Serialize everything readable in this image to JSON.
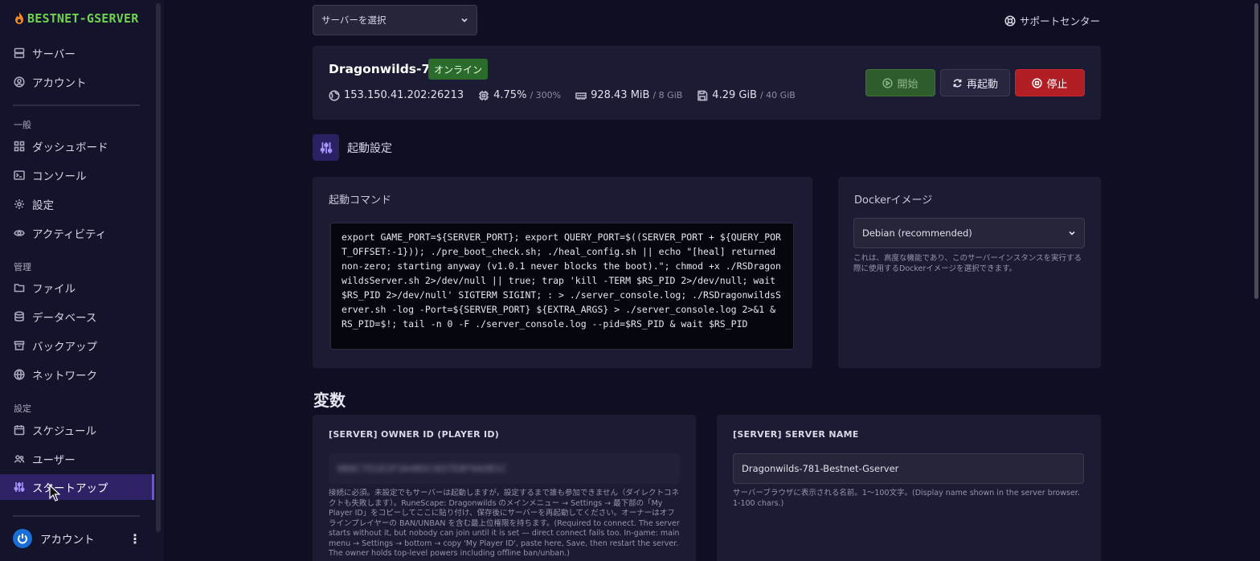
{
  "brand": {
    "name": "BESTNET-GSERVER"
  },
  "sidebar": {
    "top_items": [
      {
        "label": "サーバー",
        "icon": "server-icon"
      },
      {
        "label": "アカウント",
        "icon": "user-circle-icon"
      }
    ],
    "sections": [
      {
        "label": "一般"
      },
      {
        "label": "管理"
      },
      {
        "label": "設定"
      }
    ],
    "items": [
      {
        "label": "ダッシュボード",
        "icon": "grid-icon"
      },
      {
        "label": "コンソール",
        "icon": "terminal-icon"
      },
      {
        "label": "設定",
        "icon": "gear-icon"
      },
      {
        "label": "アクティビティ",
        "icon": "eye-icon"
      },
      {
        "label": "ファイル",
        "icon": "folder-icon"
      },
      {
        "label": "データベース",
        "icon": "database-icon"
      },
      {
        "label": "バックアップ",
        "icon": "archive-icon"
      },
      {
        "label": "ネットワーク",
        "icon": "network-icon"
      },
      {
        "label": "スケジュール",
        "icon": "calendar-icon"
      },
      {
        "label": "ユーザー",
        "icon": "users-icon"
      },
      {
        "label": "スタートアップ",
        "icon": "sliders-icon",
        "active": true
      }
    ],
    "footer": {
      "label": "アカウント",
      "icon": "power-icon"
    }
  },
  "header": {
    "server_select_placeholder": "サーバーを選択",
    "support_label": "サポートセンター"
  },
  "server": {
    "name": "Dragonwilds-781",
    "status": "オンライン",
    "address": "153.150.41.202:26213",
    "cpu": "4.75%",
    "cpu_limit": "/ 300%",
    "memory": "928.43 MiB",
    "memory_limit": "/ 8 GiB",
    "disk": "4.29 GiB",
    "disk_limit": "/ 40 GiB",
    "buttons": {
      "start": "開始",
      "restart": "再起動",
      "stop": "停止"
    }
  },
  "startup": {
    "section_title": "起動設定",
    "command_title": "起動コマンド",
    "command": "export GAME_PORT=${SERVER_PORT}; export QUERY_PORT=$((SERVER_PORT + ${QUERY_PORT_OFFSET:-1})); ./pre_boot_check.sh; ./heal_config.sh || echo \"[heal] returned non-zero; starting anyway (v1.0.1 never blocks the boot).\"; chmod +x ./RSDragonwildsServer.sh 2>/dev/null || true; trap 'kill -TERM $RS_PID 2>/dev/null; wait $RS_PID 2>/dev/null' SIGTERM SIGINT; : > ./server_console.log; ./RSDragonwildsServer.sh -log -Port=${SERVER_PORT} ${EXTRA_ARGS} > ./server_console.log 2>&1 & RS_PID=$!; tail -n 0 -F ./server_console.log --pid=$RS_PID & wait $RS_PID",
    "docker_title": "Dockerイメージ",
    "docker_value": "Debian (recommended)",
    "docker_help": "これは、高度な機能であり、このサーバーインスタンスを実行する際に使用するDockerイメージを選択できます。"
  },
  "variables": {
    "title": "変数",
    "owner": {
      "label": "[SERVER] OWNER ID (PLAYER ID)",
      "value": "9B8C7D1E2F3A4B5C6D7E8F9A0B1C",
      "help": "接続に必須。未設定でもサーバーは起動しますが，設定するまで誰も参加できません（ダイレクトコネクトも失敗します）。RuneScape: Dragonwilds のメインメニュー → Settings → 最下部の「My Player ID」をコピーしてここに貼り付け、保存後にサーバーを再起動してください。オーナーはオフラインプレイヤーの BAN/UNBAN を含む最上位権限を持ちます。(Required to connect. The server starts without it, but nobody can join until it is set — direct connect fails too. In-game: main menu → Settings → bottom → copy 'My Player ID', paste here, Save, then restart the server. The owner holds top-level powers including offline ban/unban.)"
    },
    "server_name": {
      "label": "[SERVER] SERVER NAME",
      "value": "Dragonwilds-781-Bestnet-Gserver",
      "help": "サーバーブラウザに表示される名前。1〜100文字。(Display name shown in the server browser. 1-100 chars.)"
    }
  },
  "colors": {
    "background": "#0f0f24",
    "sidebar": "#13132b",
    "card": "#1b1b34",
    "brand": "#6fd34e",
    "online": "#2b6b2b",
    "stop": "#b11f24",
    "accent": "#6c52e0"
  }
}
